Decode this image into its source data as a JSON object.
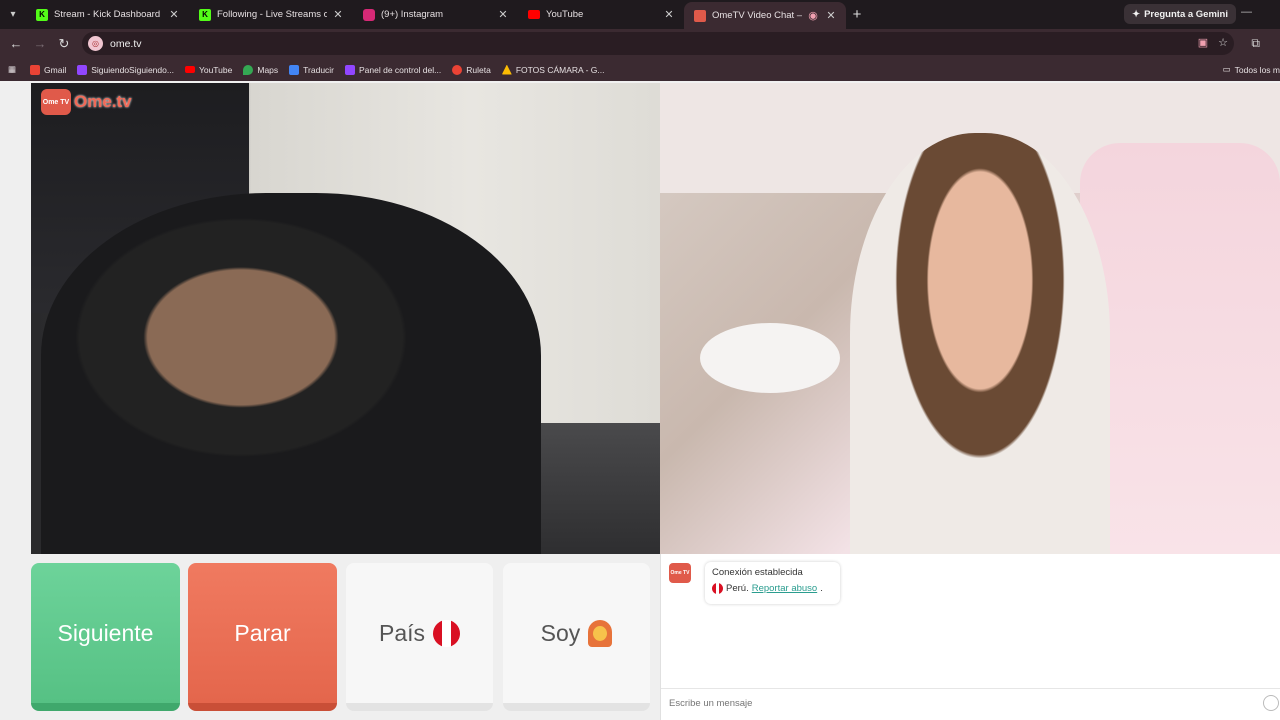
{
  "browser": {
    "tabs": [
      {
        "title": "Stream - Kick Dashboard",
        "icon": "kick-icon",
        "color": "#53fc18"
      },
      {
        "title": "Following - Live Streams on Kic",
        "icon": "kick-icon",
        "color": "#53fc18"
      },
      {
        "title": "(9+) Instagram",
        "icon": "instagram-icon",
        "color": "#d62976"
      },
      {
        "title": "YouTube",
        "icon": "youtube-icon",
        "color": "#ff0000"
      },
      {
        "title": "OmeTV Video Chat — Ome",
        "icon": "ometv-icon",
        "color": "#e05a4a",
        "active": true
      }
    ],
    "gemini_label": "Pregunta a Gemini",
    "url": "ome.tv",
    "bookmarks": [
      {
        "label": "Gmail",
        "color": "#ea4335"
      },
      {
        "label": "SiguiendoSiguiendo...",
        "color": "#9146ff"
      },
      {
        "label": "YouTube",
        "color": "#ff0000"
      },
      {
        "label": "Maps",
        "color": "#34a853"
      },
      {
        "label": "Traducir",
        "color": "#4285f4"
      },
      {
        "label": "Panel de control del...",
        "color": "#9146ff"
      },
      {
        "label": "Ruleta",
        "color": "#ea4335"
      },
      {
        "label": "FOTOS CÁMARA - G...",
        "color": "#fbbc04"
      }
    ],
    "bookmarks_all": "Todos los m"
  },
  "app": {
    "logo_text": "Ome.tv",
    "logo_badge": "Ome TV",
    "buttons": {
      "next": "Siguiente",
      "stop": "Parar",
      "country": "País",
      "gender": "Soy"
    },
    "chat": {
      "status": "Conexión establecida",
      "country": "Perú.",
      "report": "Reportar abuso",
      "report_suffix": ".",
      "placeholder": "Escribe un mensaje"
    },
    "colors": {
      "next": "#56c184",
      "stop": "#e4664c",
      "brand": "#e05a4a"
    }
  }
}
